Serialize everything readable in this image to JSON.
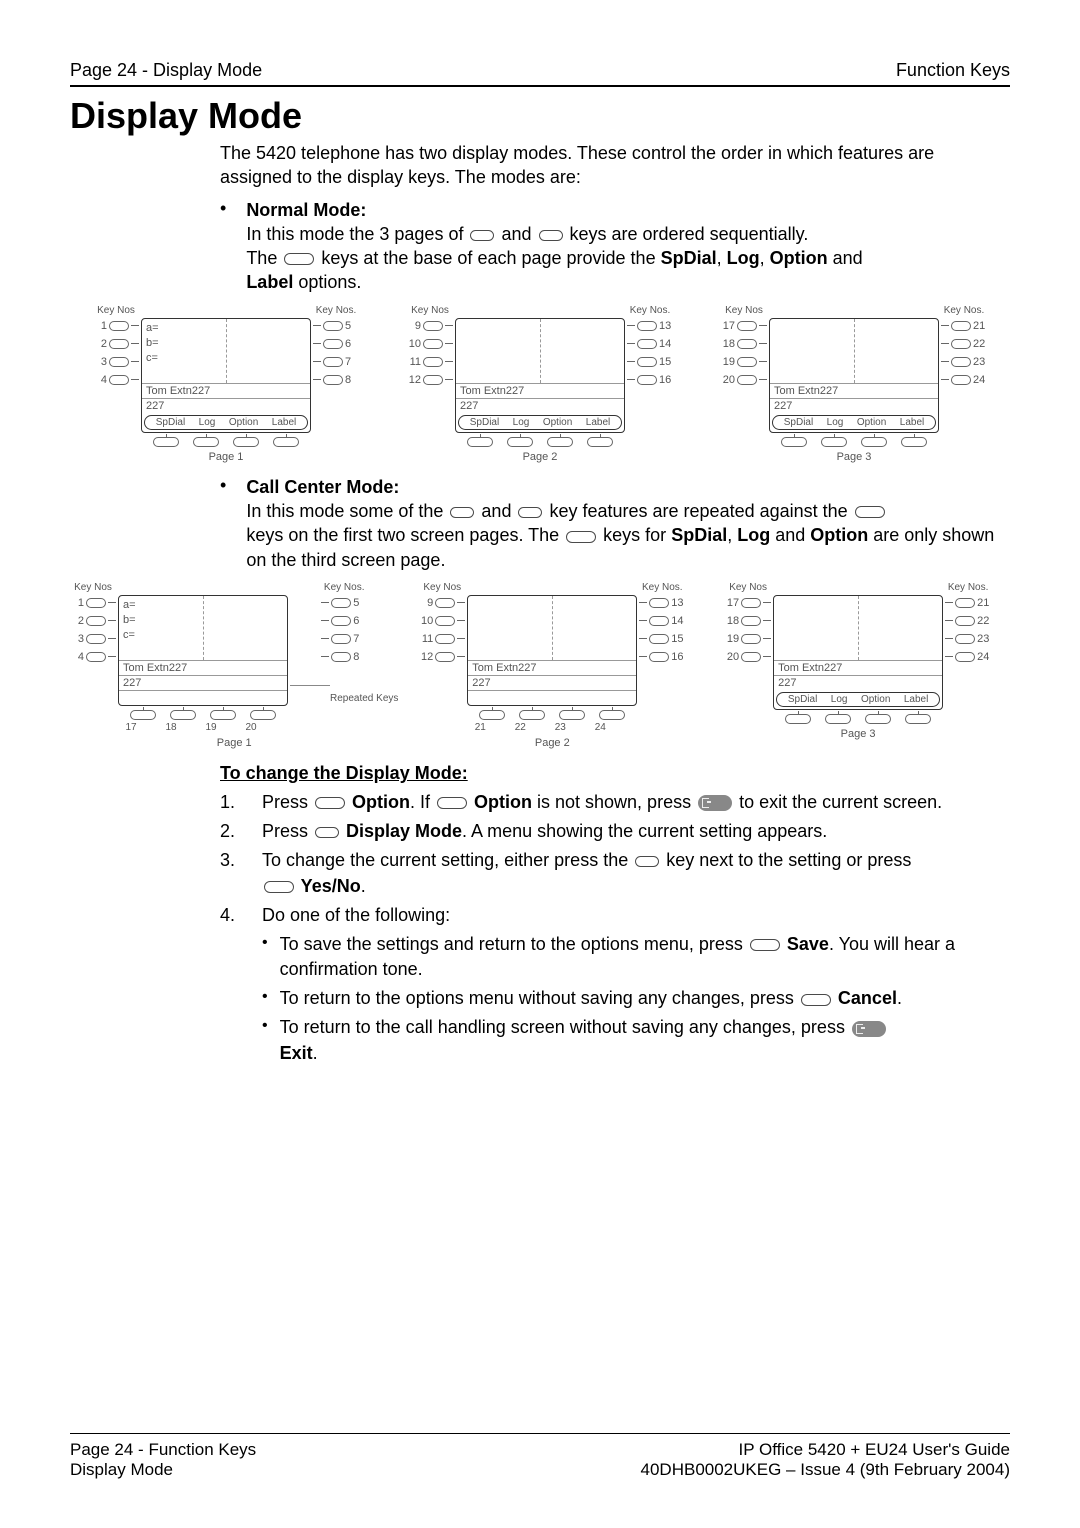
{
  "header": {
    "left": "Page 24 - Display Mode",
    "right": "Function Keys"
  },
  "title": "Display Mode",
  "intro": "The 5420 telephone has two display modes. These control the order in which features are assigned to the display keys. The modes are:",
  "normal": {
    "heading": "Normal Mode:",
    "line1a": "In this mode the 3 pages of ",
    "line1b": " and ",
    "line1c": " keys are ordered sequentially.",
    "line2a": "The ",
    "line2b": " keys at the base of each page provide the ",
    "line2c": "SpDial",
    "line2d": ", ",
    "line2e": "Log",
    "line2f": ", ",
    "line2g": "Option",
    "line2h": " and ",
    "line2i": "Label",
    "line2j": " options."
  },
  "callcenter": {
    "heading": "Call Center Mode:",
    "line1a": "In this mode some of the ",
    "line1b": " and ",
    "line1c": " key features are repeated against the ",
    "line2a": "keys on the first two screen pages. The ",
    "line2b": " keys for ",
    "line2c": "SpDial",
    "line2d": ", ",
    "line2e": "Log",
    "line2f": " and ",
    "line2g": "Option",
    "line2h": " are only shown on the third screen page."
  },
  "diagram": {
    "keynos": "Key Nos",
    "keynosdot": "Key Nos.",
    "page1": "Page 1",
    "page2": "Page 2",
    "page3": "Page 3",
    "repeated": "Repeated Keys",
    "labels": {
      "a": "a=",
      "b": "b=",
      "c": "c="
    },
    "screen": {
      "name": "Tom Extn227",
      "num": "227"
    },
    "soft": [
      "SpDial",
      "Log",
      "Option",
      "Label"
    ],
    "nums": {
      "p1l": [
        "1",
        "2",
        "3",
        "4"
      ],
      "p1r": [
        "5",
        "6",
        "7",
        "8"
      ],
      "p2l": [
        "9",
        "10",
        "11",
        "12"
      ],
      "p2r": [
        "13",
        "14",
        "15",
        "16"
      ],
      "p3l": [
        "17",
        "18",
        "19",
        "20"
      ],
      "p3r": [
        "21",
        "22",
        "23",
        "24"
      ],
      "cc_p1_soft": [
        "17",
        "18",
        "19",
        "20"
      ],
      "cc_p2_soft": [
        "21",
        "22",
        "23",
        "24"
      ]
    }
  },
  "change": {
    "title": "To change the Display Mode:",
    "steps": [
      {
        "n": "1.",
        "a": "Press ",
        "b": " Option",
        "c": ". If ",
        "d": " Option",
        "e": " is not shown, press ",
        "f": " to exit the current screen."
      },
      {
        "n": "2.",
        "a": "Press ",
        "b": " Display Mode",
        "c": ". A menu showing the current setting appears."
      },
      {
        "n": "3.",
        "a": "To change the current setting, either press the ",
        "b": " key next to the setting or press ",
        "c": " Yes/No",
        "d": "."
      },
      {
        "n": "4.",
        "a": "Do one of the following:"
      }
    ],
    "subs": [
      {
        "a": "To save the settings and return to the options menu, press ",
        "b": " Save",
        "c": ". You will hear a confirmation tone."
      },
      {
        "a": "To return to the options menu without saving any changes, press ",
        "b": " Cancel",
        "c": "."
      },
      {
        "a": "To return to the call handling screen without saving any changes, press ",
        "b": "Exit",
        "c": "."
      }
    ]
  },
  "footer": {
    "l1": "Page 24 - Function Keys",
    "l2": "Display Mode",
    "r1": "IP Office 5420 + EU24 User's Guide",
    "r2": "40DHB0002UKEG – Issue 4 (9th February 2004)"
  }
}
